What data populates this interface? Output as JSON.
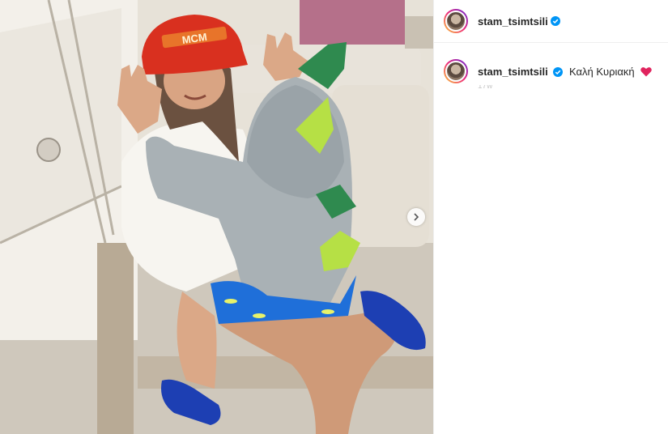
{
  "post": {
    "author": "stam_tsimtsili",
    "caption": "Καλή Κυριακή",
    "caption_emoji": "red-heart-icon",
    "timestamp": "17w",
    "verified": true
  },
  "photo": {
    "hat_text": "MCM",
    "alt": "Photo by stam_tsimtsili"
  },
  "colors": {
    "verified": "#0095f6",
    "heart": "#e0245e",
    "story_ring": "#ee2a7b"
  }
}
